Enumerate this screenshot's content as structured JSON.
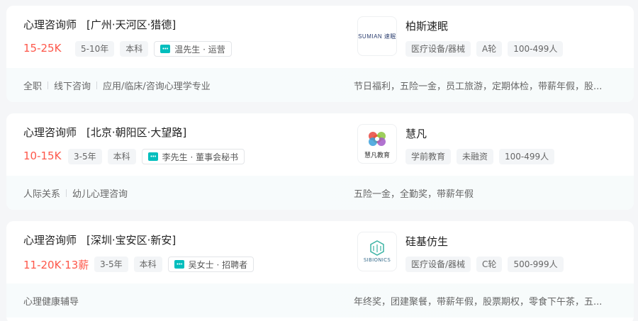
{
  "jobs": [
    {
      "title": "心理咨询师",
      "location": "[广州·天河区·猎德]",
      "salary": "15-25K",
      "tags": [
        "5-10年",
        "本科"
      ],
      "recruiter": "温先生 · 运营",
      "company_name": "柏斯速眠",
      "logo_text": "SUMIAN 速眠",
      "company_tags": [
        "医疗设备/器械",
        "A轮",
        "100-499人"
      ],
      "skills": [
        "全职",
        "线下咨询",
        "应用/临床/咨询心理学专业"
      ],
      "welfare": "节日福利，五险一金，员工旅游，定期体检，带薪年假，股..."
    },
    {
      "title": "心理咨询师",
      "location": "[北京·朝阳区·大望路]",
      "salary": "10-15K",
      "tags": [
        "3-5年",
        "本科"
      ],
      "recruiter": "李先生 · 董事会秘书",
      "company_name": "慧凡",
      "logo_text": "慧凡教育",
      "company_tags": [
        "学前教育",
        "未融资",
        "100-499人"
      ],
      "skills": [
        "人际关系",
        "幼儿心理咨询"
      ],
      "welfare": "五险一金，全勤奖，带薪年假"
    },
    {
      "title": "心理咨询师",
      "location": "[深圳·宝安区·新安]",
      "salary": "11-20K·13薪",
      "tags": [
        "3-5年",
        "本科"
      ],
      "recruiter": "吴女士 · 招聘者",
      "company_name": "硅基仿生",
      "logo_text": "SIBIONICS",
      "company_tags": [
        "医疗设备/器械",
        "C轮",
        "500-999人"
      ],
      "skills": [
        "心理健康辅导"
      ],
      "welfare": "年终奖，团建聚餐，带薪年假，股票期权，零食下午茶，五..."
    }
  ]
}
